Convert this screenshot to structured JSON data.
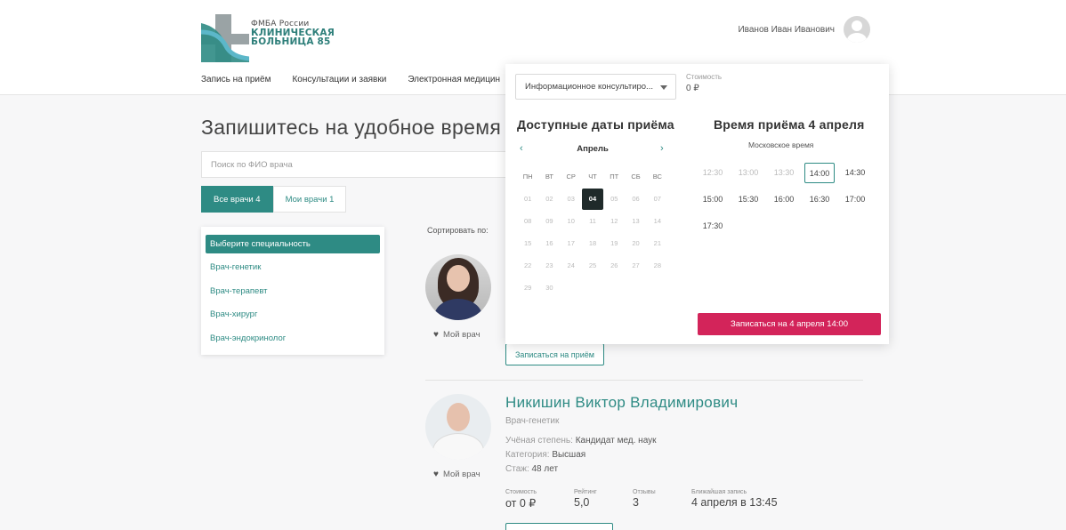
{
  "header": {
    "logo": {
      "line1": "ФМБА России",
      "line2": "КЛИНИЧЕСКАЯ",
      "line3": "БОЛЬНИЦА 85"
    },
    "user_name": "Иванов Иван Иванович",
    "nav": [
      "Запись на приём",
      "Консультации и заявки",
      "Электронная медицин"
    ]
  },
  "main": {
    "title": "Запишитесь на удобное время",
    "search_placeholder": "Поиск по ФИО врача",
    "tabs": [
      {
        "label": "Все врачи 4"
      },
      {
        "label": "Мои врачи 1"
      }
    ],
    "specialties": {
      "selected": "Выберите специальность",
      "items": [
        "Врач-генетик",
        "Врач-терапевт",
        "Врач-хирург",
        "Врач-эндокринолог"
      ]
    },
    "sort_label": "Сортировать по:",
    "doctor1": {
      "my_doctor": "Мой врач",
      "book_button": "Записаться на приём"
    },
    "doctor2": {
      "name": "Никишин Виктор Владимирович",
      "specialty": "Врач-генетик",
      "degree_label": "Учёная степень:",
      "degree": "Кандидат мед. наук",
      "category_label": "Категория:",
      "category": "Высшая",
      "experience_label": "Стаж:",
      "experience": "48 лет",
      "my_doctor": "Мой врач",
      "stats": [
        {
          "label": "Стоимость",
          "value": "от 0 ₽"
        },
        {
          "label": "Рейтинг",
          "value": "5,0"
        },
        {
          "label": "Отзывы",
          "value": "3"
        },
        {
          "label": "Ближайшая запись",
          "value": "4 апреля в 13:45"
        }
      ]
    }
  },
  "popup": {
    "service_select": "Информационное консультиро...",
    "cost_label": "Стоимость",
    "cost_value": "0 ₽",
    "dates_title": "Доступные даты приёма",
    "times_title": "Время приёма 4 апреля",
    "month": "Апрель",
    "weekdays": [
      "ПН",
      "ВТ",
      "СР",
      "ЧТ",
      "ПТ",
      "СБ",
      "ВС"
    ],
    "weeks": [
      [
        "01",
        "02",
        "03",
        "04",
        "05",
        "06",
        "07"
      ],
      [
        "08",
        "09",
        "10",
        "11",
        "12",
        "13",
        "14"
      ],
      [
        "15",
        "16",
        "17",
        "18",
        "19",
        "20",
        "21"
      ],
      [
        "22",
        "23",
        "24",
        "25",
        "26",
        "27",
        "28"
      ],
      [
        "29",
        "30",
        "",
        "",
        "",
        "",
        ""
      ]
    ],
    "selected_date": "04",
    "timezone": "Московское время",
    "slots": [
      [
        {
          "t": "12:30",
          "state": "disabled"
        },
        {
          "t": "13:00",
          "state": "disabled"
        },
        {
          "t": "13:30",
          "state": "disabled"
        },
        {
          "t": "14:00",
          "state": "selected"
        },
        {
          "t": "14:30",
          "state": "available"
        }
      ],
      [
        {
          "t": "15:00",
          "state": "available"
        },
        {
          "t": "15:30",
          "state": "available"
        },
        {
          "t": "16:00",
          "state": "available"
        },
        {
          "t": "16:30",
          "state": "available"
        },
        {
          "t": "17:00",
          "state": "available"
        }
      ],
      [
        {
          "t": "17:30",
          "state": "available"
        }
      ]
    ],
    "book_button": "Записаться на 4 апреля 14:00",
    "colors": {
      "accent": "#2e8b84",
      "cta": "#d3245a",
      "selected_date": "#1f2a2a"
    }
  }
}
